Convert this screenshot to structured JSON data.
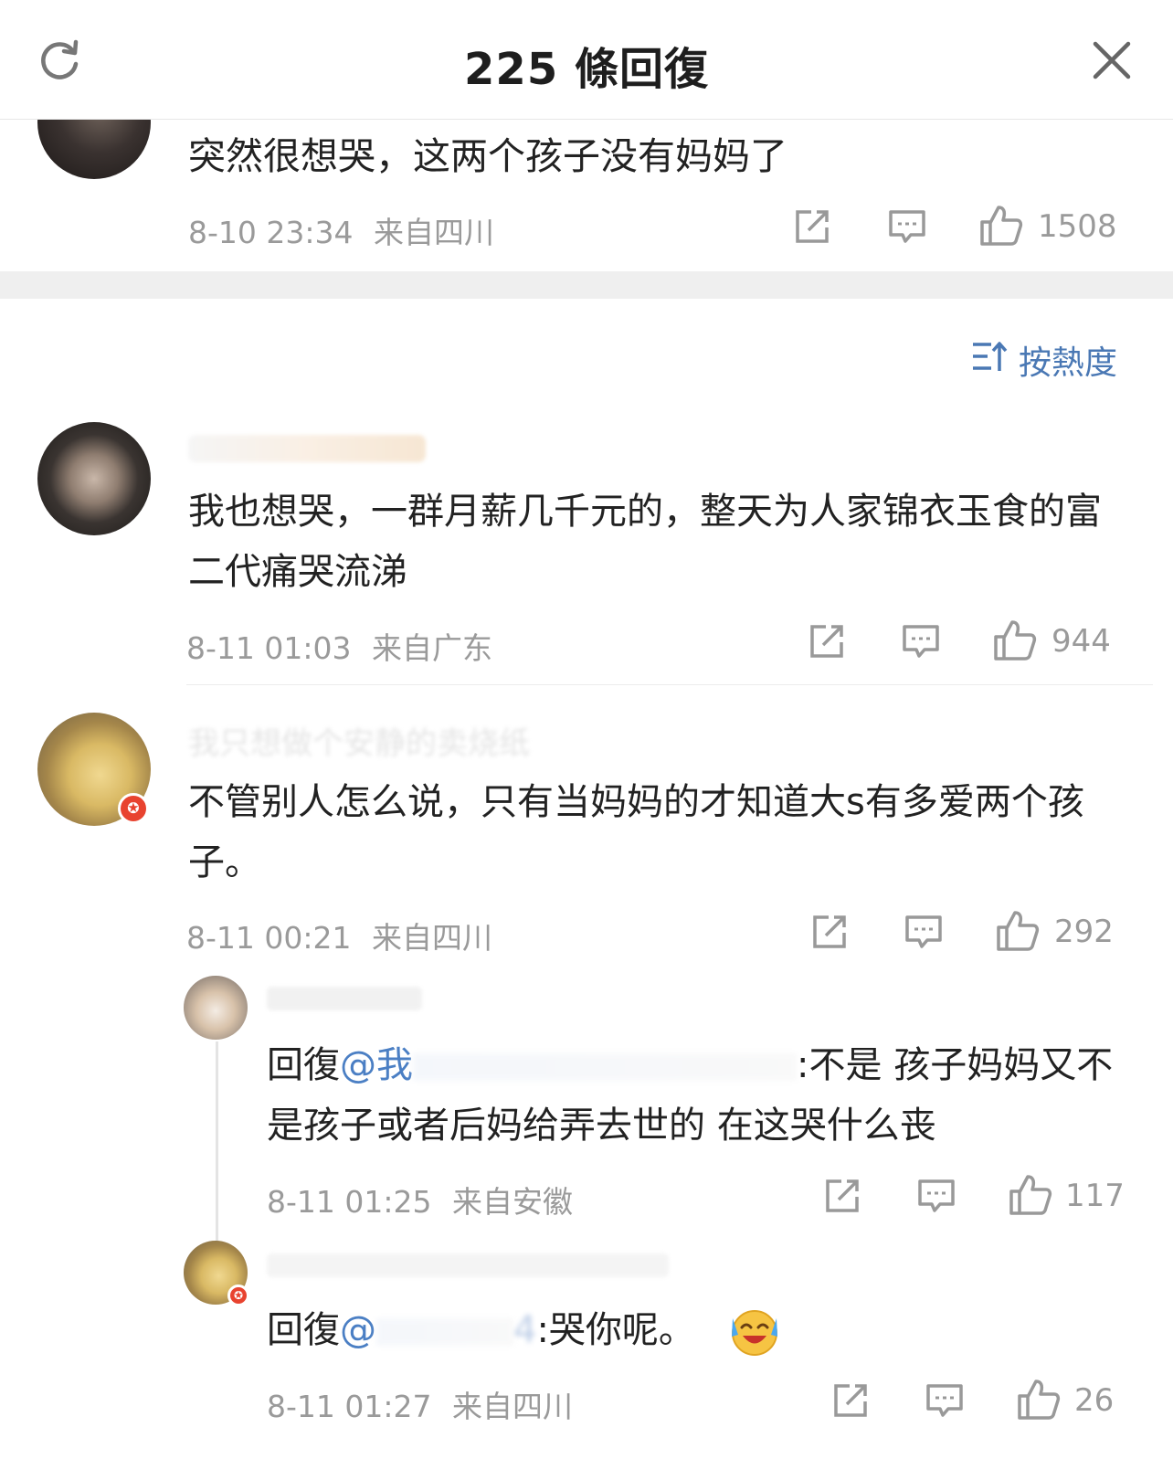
{
  "header": {
    "title": "225 條回復"
  },
  "icons": {
    "refresh": "refresh-icon",
    "close": "close-icon",
    "share": "share-icon",
    "comment": "comment-icon",
    "like": "thumbs-up-icon",
    "sort": "sort-icon"
  },
  "colors": {
    "link": "#4b7fc4",
    "meta": "#9a9a9a",
    "text": "#222222",
    "badge": "#e8432f"
  },
  "sort": {
    "label": "按熱度"
  },
  "top_comment": {
    "text": "突然很想哭，这两个孩子没有妈妈了",
    "time": "8-10 23:34",
    "location": "来自四川",
    "likes": "1508"
  },
  "comments": [
    {
      "text": "我也想哭，一群月薪几千元的，整天为人家锦衣玉食的富二代痛哭流涕",
      "time": "8-11 01:03",
      "location": "来自广东",
      "likes": "944"
    },
    {
      "name": "我只想做个安静的卖烧纸",
      "text": "不管别人怎么说，只有当妈妈的才知道大s有多爱两个孩子。",
      "time": "8-11 00:21",
      "location": "来自四川",
      "likes": "292"
    }
  ],
  "replies": [
    {
      "reply_prefix": "回復",
      "mention_visible": "@我",
      "mention_tail": ":",
      "text": "不是 孩子妈妈又不是孩子或者后妈给弄去世的 在这哭什么丧",
      "time": "8-11 01:25",
      "location": "来自安徽",
      "likes": "117"
    },
    {
      "reply_prefix": "回復",
      "mention_visible": "@",
      "mention_tail": "4",
      "text": ":哭你呢。",
      "time": "8-11 01:27",
      "location": "来自四川",
      "likes": "26"
    }
  ]
}
